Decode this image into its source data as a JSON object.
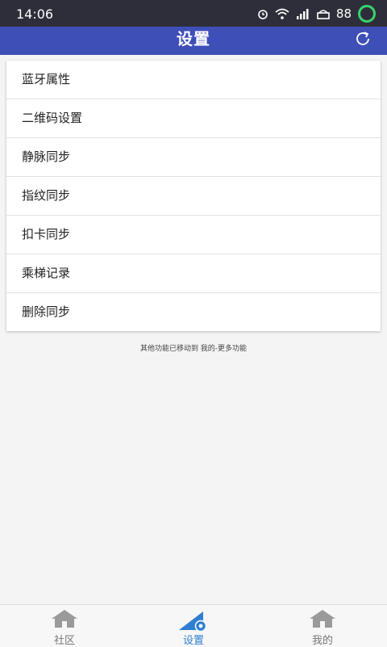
{
  "status_bar": {
    "time": "14:06",
    "battery": "88"
  },
  "app_bar": {
    "title": "设置",
    "refresh_icon": "refresh-icon"
  },
  "menu": {
    "items": [
      {
        "label": "蓝牙属性"
      },
      {
        "label": "二维码设置"
      },
      {
        "label": "静脉同步"
      },
      {
        "label": "指纹同步"
      },
      {
        "label": "扣卡同步"
      },
      {
        "label": "乘梯记录"
      },
      {
        "label": "删除同步"
      }
    ]
  },
  "hint": "其他功能已移动到 我的-更多功能",
  "tabs": [
    {
      "label": "社区",
      "icon": "home-icon",
      "active": false
    },
    {
      "label": "设置",
      "icon": "settings-icon",
      "active": true
    },
    {
      "label": "我的",
      "icon": "home-icon",
      "active": false
    }
  ],
  "colors": {
    "app_bar": "#3f4fb8",
    "accent": "#2f7fd0",
    "battery": "#39d26b"
  }
}
